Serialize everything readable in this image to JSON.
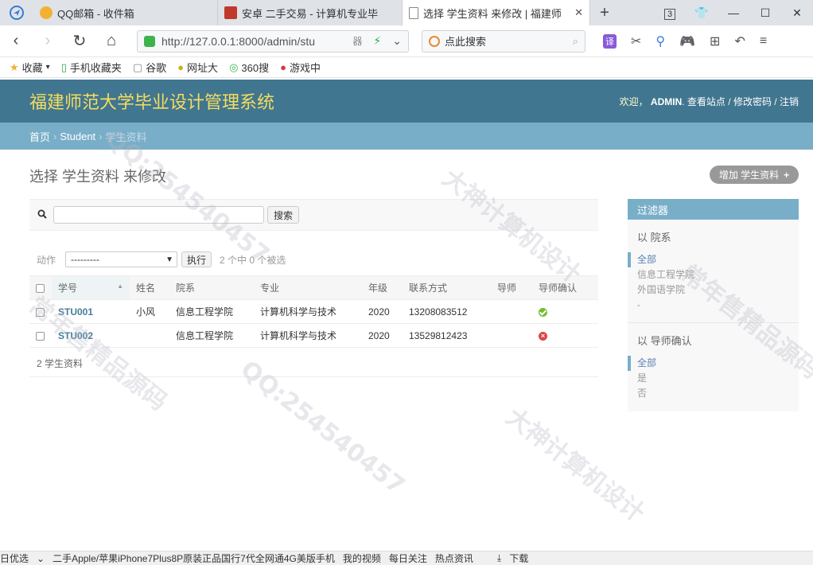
{
  "browser": {
    "tabs": [
      {
        "title": "QQ邮箱 - 收件箱",
        "active": false
      },
      {
        "title": "安卓 二手交易 - 计算机专业毕",
        "active": false
      },
      {
        "title": "选择 学生资料 来修改 | 福建师",
        "active": true
      }
    ],
    "tab_count": "3",
    "url": "http://127.0.0.1:8000/admin/stu",
    "url_extra": "器",
    "search_placeholder": "点此搜索",
    "translate_label": "译",
    "bookmarks": [
      "收藏",
      "手机收藏夹",
      "谷歌",
      "网址大",
      "360搜",
      "游戏中"
    ]
  },
  "admin": {
    "site_title": "福建师范大学毕业设计管理系统",
    "welcome": "欢迎，",
    "username": "ADMIN",
    "links": [
      "查看站点",
      "修改密码",
      "注销"
    ],
    "breadcrumbs": {
      "home": "首页",
      "app": "Student",
      "current": "学生资料"
    },
    "page_title": "选择 学生资料 来修改",
    "add_label": "增加 学生资料",
    "search_button": "搜索",
    "action_label": "动作",
    "action_select": "---------",
    "go_button": "执行",
    "counter": "2 个中 0 个被选",
    "columns": [
      "学号",
      "姓名",
      "院系",
      "专业",
      "年级",
      "联系方式",
      "导师",
      "导师确认"
    ],
    "rows": [
      {
        "id": "STU001",
        "name": "小风",
        "dept": "信息工程学院",
        "major": "计算机科学与技术",
        "grade": "2020",
        "contact": "13208083512",
        "tutor": "",
        "confirmed": true
      },
      {
        "id": "STU002",
        "name": "",
        "dept": "信息工程学院",
        "major": "计算机科学与技术",
        "grade": "2020",
        "contact": "13529812423",
        "tutor": "",
        "confirmed": false
      }
    ],
    "paginator": "2 学生资料",
    "filter": {
      "title": "过滤器",
      "groups": [
        {
          "title": "以 院系",
          "items": [
            "全部",
            "信息工程学院",
            "外国语学院",
            "-"
          ]
        },
        {
          "title": "以 导师确认",
          "items": [
            "全部",
            "是",
            "否"
          ]
        }
      ]
    }
  },
  "statusbar": [
    "日优选",
    "二手Apple/苹果iPhone7Plus8P原装正品国行7代全网通4G美版手机",
    "我的视频",
    "每日关注",
    "热点资讯",
    "下载"
  ],
  "watermarks": [
    "QQ:254540457",
    "大神计算机设计",
    "常年售精品源码"
  ]
}
